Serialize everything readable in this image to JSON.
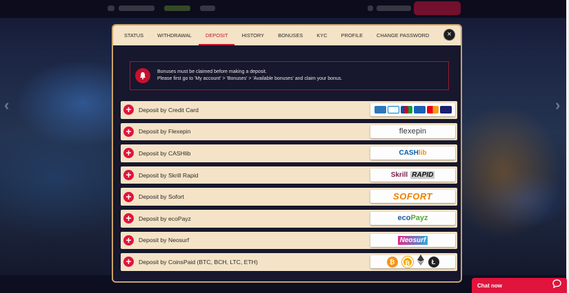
{
  "tabs": [
    {
      "label": "STATUS"
    },
    {
      "label": "WITHDRAWAL"
    },
    {
      "label": "DEPOSIT"
    },
    {
      "label": "HISTORY"
    },
    {
      "label": "BONUSES"
    },
    {
      "label": "KYC"
    },
    {
      "label": "PROFILE"
    },
    {
      "label": "CHANGE PASSWORD"
    }
  ],
  "active_tab": "DEPOSIT",
  "close_symbol": "×",
  "notice": {
    "line1": "Bonuses must be claimed before making a deposit.",
    "line2": "Please first go to 'My account' > 'Bonuses' > 'Available bonuses' and claim your bonus.",
    "icon": "bell-icon",
    "accent": "#c8102e"
  },
  "methods": [
    {
      "label": "Deposit by Credit Card",
      "logo_icon": "card-logos-icon"
    },
    {
      "label": "Deposit by Flexepin",
      "logo_text": "flexepin"
    },
    {
      "label": "Deposit by CASHlib",
      "logo_text_a": "CASH",
      "logo_text_b": "lib"
    },
    {
      "label": "Deposit by Skrill Rapid",
      "logo_text_a": "Skrill",
      "logo_text_b": "RAPID"
    },
    {
      "label": "Deposit by Sofort",
      "logo_text": "SOFORT"
    },
    {
      "label": "Deposit by ecoPayz",
      "logo_text_a": "eco",
      "logo_text_b": "Payz"
    },
    {
      "label": "Deposit by Neosurf",
      "logo_text": "Neosurf"
    },
    {
      "label": "Deposit by CoinsPaid (BTC, BCH, LTC, ETH)",
      "logo_icons": [
        "bitcoin-icon",
        "bitcoin-cash-icon",
        "ethereum-icon",
        "litecoin-icon"
      ]
    }
  ],
  "plus_symbol": "+",
  "chat": {
    "label": "Chat now",
    "icon": "chat-bubble-icon"
  },
  "colors": {
    "brand_red": "#e0143c",
    "panel_bg": "#17172d",
    "row_bg": "#f4e3c6",
    "border_gold": "#c9a36b"
  }
}
